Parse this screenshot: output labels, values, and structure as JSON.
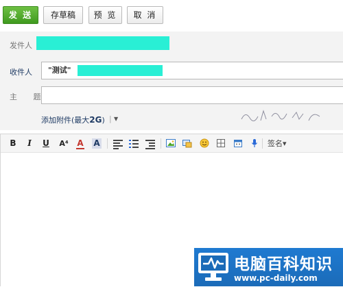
{
  "toolbar": {
    "send_label": "发 送",
    "draft_label": "存草稿",
    "preview_label": "预 览",
    "cancel_label": "取 消"
  },
  "compose": {
    "from_label": "发件人",
    "to_label": "收件人",
    "to_value": "\"测试\"",
    "subject_label": "主 题",
    "subject_value": "",
    "attach_label_prefix": "添加附件(最大",
    "attach_label_size": "2G",
    "attach_label_suffix": ")"
  },
  "editor": {
    "tools": {
      "bold": "B",
      "italic": "I",
      "underline": "U",
      "font_size": "A⁴",
      "font_color": "A",
      "bg_color": "A"
    },
    "signature_label": "签名▾",
    "body": ""
  },
  "watermark": {
    "title": "电脑百科知识",
    "url": "www.pc-daily.com"
  },
  "colors": {
    "send_green": "#4aa52a",
    "mask_cyan": "#29efd5",
    "panel_gray": "#f3f3f3",
    "watermark_blue": "#1f7ad1"
  }
}
